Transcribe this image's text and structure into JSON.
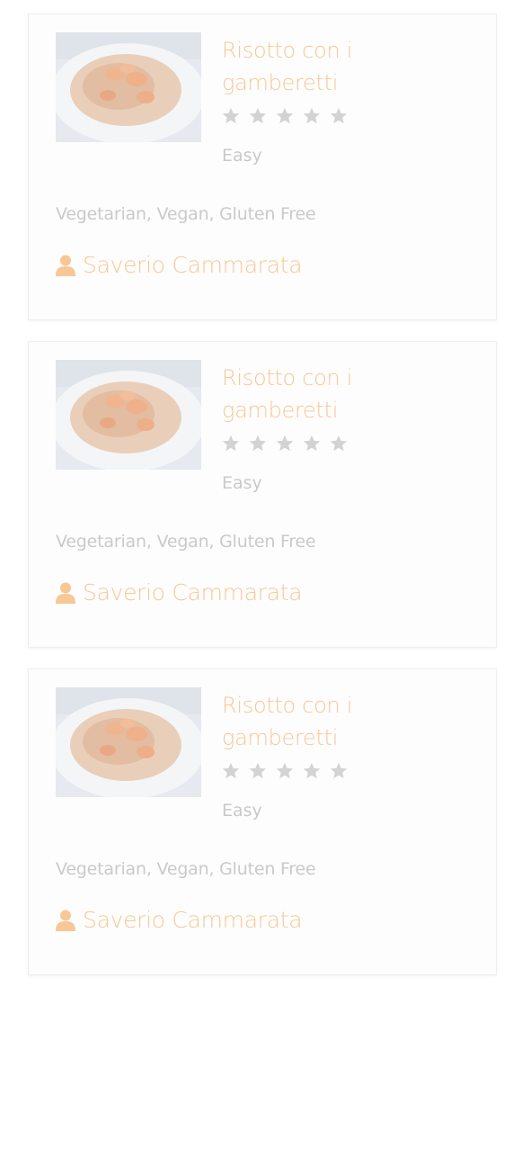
{
  "recipes": [
    {
      "title": "Risotto con i gamberetti",
      "rating_filled": 0,
      "rating_max": 5,
      "difficulty": "Easy",
      "diets": "Vegetarian, Vegan, Gluten Free",
      "author": "Saverio Cammarata",
      "image_alt": "risotto-with-shrimp-photo"
    },
    {
      "title": "Risotto con i gamberetti",
      "rating_filled": 0,
      "rating_max": 5,
      "difficulty": "Easy",
      "diets": "Vegetarian, Vegan, Gluten Free",
      "author": "Saverio Cammarata",
      "image_alt": "risotto-with-shrimp-photo"
    },
    {
      "title": "Risotto con i gamberetti",
      "rating_filled": 0,
      "rating_max": 5,
      "difficulty": "Easy",
      "diets": "Vegetarian, Vegan, Gluten Free",
      "author": "Saverio Cammarata",
      "image_alt": "risotto-with-shrimp-photo"
    }
  ],
  "icons": {
    "star": "star-icon",
    "author": "user-icon"
  },
  "colors": {
    "accent": "#f8c796",
    "muted_text": "#c9c9c9",
    "star_empty": "#d3d3d3",
    "card_bg": "#fdfdfd"
  }
}
